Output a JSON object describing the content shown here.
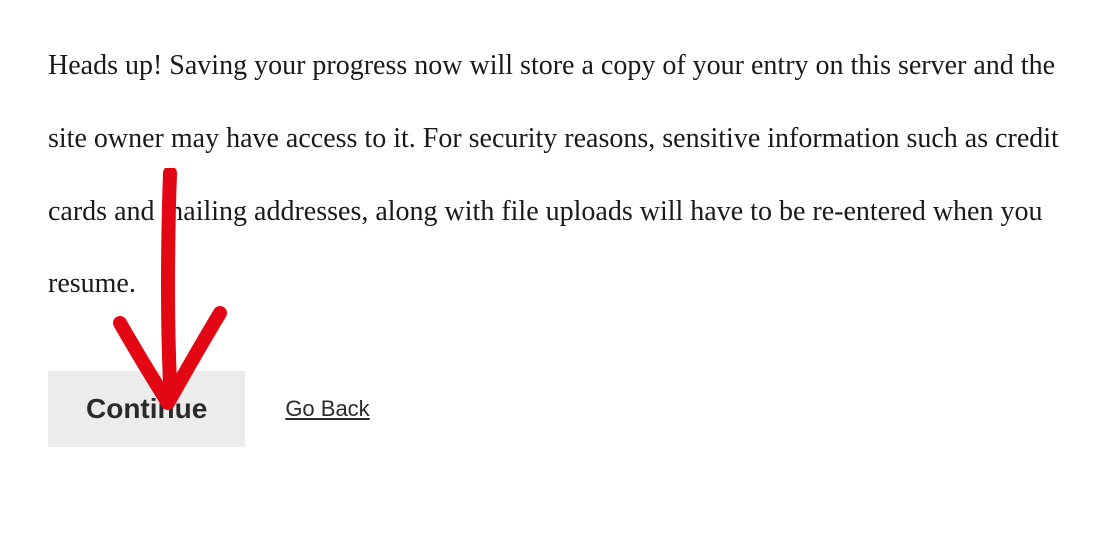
{
  "message": {
    "text": "Heads up! Saving your progress now will store a copy of your entry on this server and the site owner may have access to it. For security reasons, sensitive information such as credit cards and mailing addresses, along with file uploads will have to be re-entered when you resume."
  },
  "actions": {
    "continue_label": "Continue",
    "go_back_label": "Go Back"
  },
  "annotation": {
    "color": "#e30613",
    "type": "arrow-down"
  }
}
